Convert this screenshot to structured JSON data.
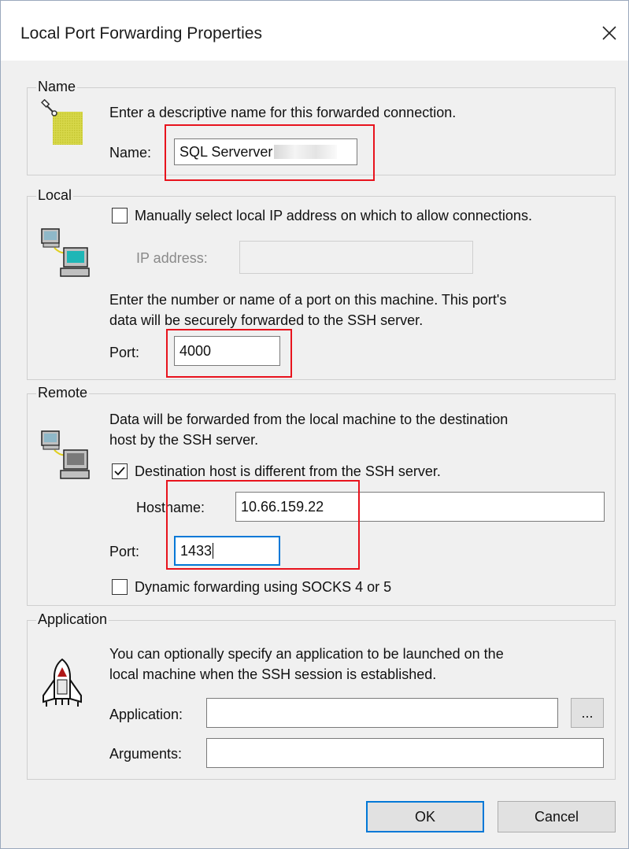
{
  "window": {
    "title": "Local Port Forwarding Properties"
  },
  "name_group": {
    "legend": "Name",
    "description": "Enter a descriptive name for this forwarded connection.",
    "name_label": "Name:",
    "name_value": "SQL Serverver"
  },
  "local_group": {
    "legend": "Local",
    "manual_ip_label": "Manually select local IP address on which to allow connections.",
    "manual_ip_checked": false,
    "ip_label": "IP address:",
    "ip_value": "",
    "port_description_1": "Enter the number or name of a port on this machine.  This port's",
    "port_description_2": "data will be securely forwarded to the SSH server.",
    "port_label": "Port:",
    "port_value": "4000"
  },
  "remote_group": {
    "legend": "Remote",
    "description_1": "Data will be forwarded from the local machine to the destination",
    "description_2": "host by the SSH server.",
    "dest_diff_label": "Destination host is different from the SSH server.",
    "dest_diff_checked": true,
    "hostname_label": "Hostname:",
    "hostname_value": "10.66.159.22",
    "port_label": "Port:",
    "port_value": "1433",
    "dynamic_label": "Dynamic forwarding using SOCKS 4 or 5",
    "dynamic_checked": false
  },
  "application_group": {
    "legend": "Application",
    "description_1": "You can optionally specify an application to be launched on the",
    "description_2": "local machine when the SSH session is established.",
    "application_label": "Application:",
    "application_value": "",
    "browse_label": "...",
    "arguments_label": "Arguments:",
    "arguments_value": ""
  },
  "buttons": {
    "ok": "OK",
    "cancel": "Cancel"
  },
  "icons": {
    "close": "close-icon",
    "name_tag": "name-tag-icon",
    "local_computers": "local-computers-icon",
    "remote_computers": "remote-computers-icon",
    "shuttle": "space-shuttle-icon"
  },
  "colors": {
    "accent": "#0078d7",
    "highlight_box": "#e8131d"
  }
}
